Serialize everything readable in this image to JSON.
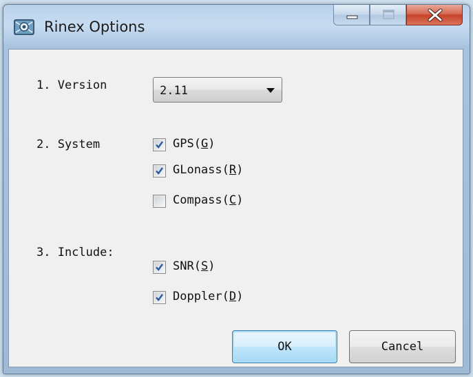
{
  "window": {
    "title": "Rinex Options",
    "icon": "satellite-app-icon",
    "controls": {
      "minimize_icon": "minimize-icon",
      "maximize_icon": "maximize-icon",
      "close_icon": "close-icon",
      "close_color": "#c7432a"
    }
  },
  "form": {
    "version": {
      "label": "1. Version",
      "selected": "2.11",
      "dropdown_icon": "chevron-down-icon"
    },
    "system": {
      "label": "2. System",
      "options": [
        {
          "name": "GPS",
          "mnemonic": "G",
          "checked": true
        },
        {
          "name": "GLonass",
          "mnemonic": "R",
          "checked": true
        },
        {
          "name": "Compass",
          "mnemonic": "C",
          "checked": false
        }
      ]
    },
    "include": {
      "label": "3. Include:",
      "options": [
        {
          "name": "SNR",
          "mnemonic": "S",
          "checked": true
        },
        {
          "name": "Doppler",
          "mnemonic": "D",
          "checked": true
        }
      ]
    }
  },
  "buttons": {
    "ok": "OK",
    "cancel": "Cancel"
  },
  "colors": {
    "titlebar": "#b9d1ea",
    "client_bg": "#f0f0f0",
    "check_color": "#2b5aa0",
    "default_button_border": "#3c7fb1"
  }
}
